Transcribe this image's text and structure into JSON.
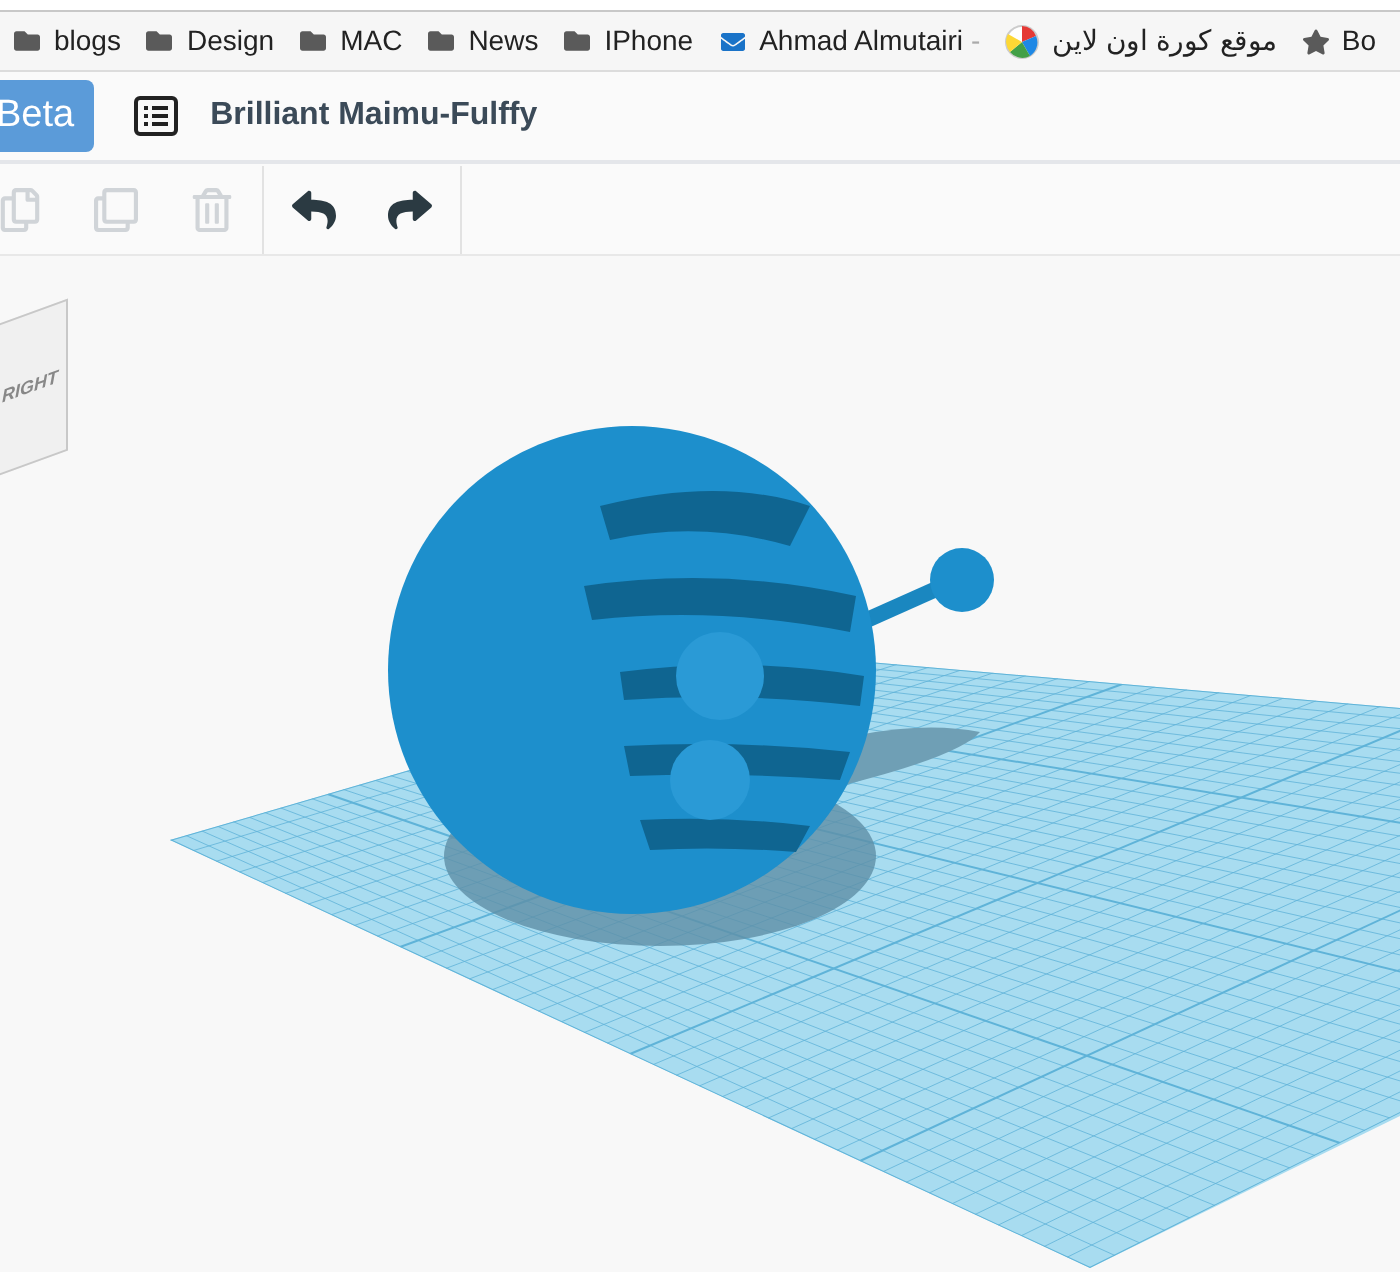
{
  "bookmarks": [
    {
      "kind": "folder",
      "label": "blogs"
    },
    {
      "kind": "folder",
      "label": "Design"
    },
    {
      "kind": "folder",
      "label": "MAC"
    },
    {
      "kind": "folder",
      "label": "News"
    },
    {
      "kind": "folder",
      "label": "IPhone"
    },
    {
      "kind": "mail",
      "label": "Ahmad Almutairi",
      "suffix": "-"
    },
    {
      "kind": "site",
      "label": "موقع كورة اون لاين"
    },
    {
      "kind": "star",
      "label": "Bo"
    }
  ],
  "header": {
    "badge": "Beta",
    "title": "Brilliant Maimu-Fulffy"
  },
  "toolbar": [
    {
      "kind": "copy",
      "disabled": true
    },
    {
      "kind": "duplicate",
      "disabled": true
    },
    {
      "kind": "delete",
      "disabled": true
    },
    {
      "kind": "undo",
      "disabled": false
    },
    {
      "kind": "redo",
      "disabled": false
    }
  ],
  "view_cube": {
    "face_label": "RIGHT"
  }
}
